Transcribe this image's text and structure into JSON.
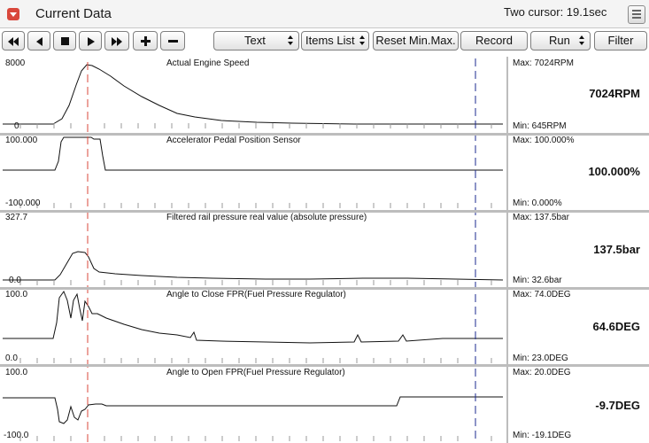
{
  "window": {
    "title": "Current Data",
    "cursor_info": "Two cursor: 19.1sec",
    "title_icon": "dropdown-icon",
    "menu_icon": "menu-icon"
  },
  "toolbar": {
    "rewind_icon": "rewind-icon",
    "step_back_icon": "step-back-icon",
    "stop_icon": "stop-icon",
    "play_icon": "play-icon",
    "fast_forward_icon": "fast-forward-icon",
    "zoom_in_icon": "plus-icon",
    "zoom_out_icon": "minus-icon",
    "text_label": "Text",
    "items_list_label": "Items List",
    "reset_label": "Reset Min.Max.",
    "record_label": "Record",
    "run_label": "Run",
    "filter_label": "Filter"
  },
  "colors": {
    "cursor_left": "#d9473b",
    "cursor_right": "#1b2a8f",
    "separator": "#bdbdbd",
    "trace": "#000000"
  },
  "graphs": [
    {
      "title": "Actual Engine Speed",
      "y_top": "8000",
      "y_bottom": "0",
      "max": "Max: 7024RPM",
      "min": "Min: 645RPM",
      "value": "7024RPM"
    },
    {
      "title": "Accelerator Pedal Position Sensor",
      "y_top": "100.000",
      "y_bottom": "-100.000",
      "max": "Max: 100.000%",
      "min": "Min: 0.000%",
      "value": "100.000%"
    },
    {
      "title": "Filtered rail pressure real value (absolute pressure)",
      "y_top": "327.7",
      "y_bottom": "0.0",
      "max": "Max: 137.5bar",
      "min": "Min: 32.6bar",
      "value": "137.5bar"
    },
    {
      "title": "Angle to Close FPR(Fuel Pressure Regulator)",
      "y_top": "100.0",
      "y_bottom": "0.0",
      "max": "Max: 74.0DEG",
      "min": "Min: 23.0DEG",
      "value": "64.6DEG"
    },
    {
      "title": "Angle to Open FPR(Fuel Pressure Regulator)",
      "y_top": "100.0",
      "y_bottom": "-100.0",
      "max": "Max: 20.0DEG",
      "min": "Min: -19.1DEG",
      "value": "-9.7DEG"
    }
  ]
}
